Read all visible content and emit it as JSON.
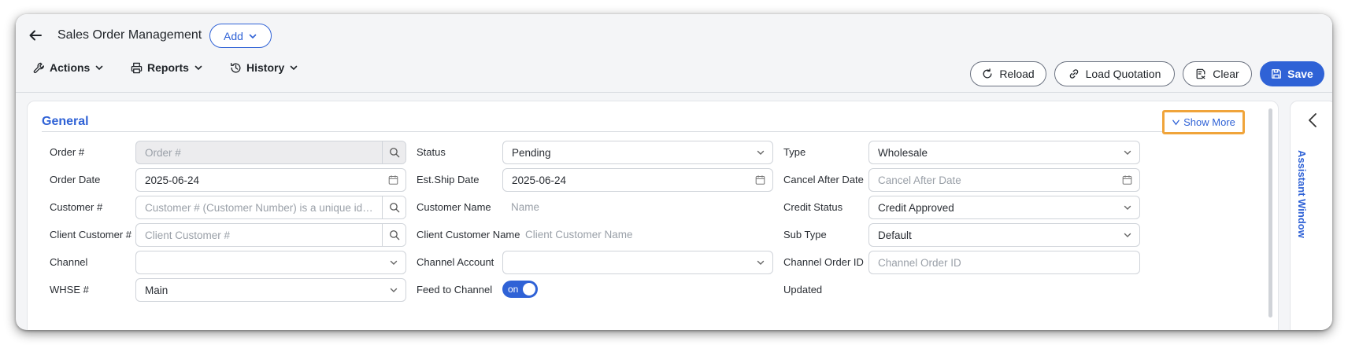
{
  "header": {
    "title": "Sales Order Management",
    "add_label": "Add"
  },
  "menus": {
    "actions": "Actions",
    "reports": "Reports",
    "history": "History"
  },
  "toolbar": {
    "reload": "Reload",
    "load_quotation": "Load Quotation",
    "clear": "Clear",
    "save": "Save"
  },
  "section": {
    "title": "General",
    "show_more": "Show More"
  },
  "form": {
    "order_no": {
      "label": "Order #",
      "placeholder": "Order #"
    },
    "order_date": {
      "label": "Order Date",
      "value": "2025-06-24"
    },
    "customer_no": {
      "label": "Customer #",
      "placeholder": "Customer # (Customer Number) is a unique iden..."
    },
    "client_customer_no": {
      "label": "Client Customer #",
      "placeholder": "Client Customer #"
    },
    "channel": {
      "label": "Channel",
      "value": ""
    },
    "whse": {
      "label": "WHSE #",
      "value": "Main"
    },
    "status": {
      "label": "Status",
      "value": "Pending"
    },
    "est_ship_date": {
      "label": "Est.Ship Date",
      "value": "2025-06-24"
    },
    "customer_name": {
      "label": "Customer Name",
      "placeholder": "Name"
    },
    "client_customer_name": {
      "label": "Client Customer Name",
      "placeholder": "Client Customer Name"
    },
    "channel_account": {
      "label": "Channel Account",
      "value": ""
    },
    "feed_to_channel": {
      "label": "Feed to Channel",
      "toggle_text": "on",
      "enabled": true
    },
    "type": {
      "label": "Type",
      "value": "Wholesale"
    },
    "cancel_after_date": {
      "label": "Cancel After Date",
      "placeholder": "Cancel After Date"
    },
    "credit_status": {
      "label": "Credit Status",
      "value": "Credit Approved"
    },
    "sub_type": {
      "label": "Sub Type",
      "value": "Default"
    },
    "channel_order_id": {
      "label": "Channel Order ID",
      "placeholder": "Channel Order ID"
    },
    "updated": {
      "label": "Updated"
    }
  },
  "assistant": {
    "label": "Assistant Window"
  },
  "colors": {
    "accent": "#2f62d6",
    "highlight": "#f0a43a",
    "border": "#cfd3d9"
  }
}
